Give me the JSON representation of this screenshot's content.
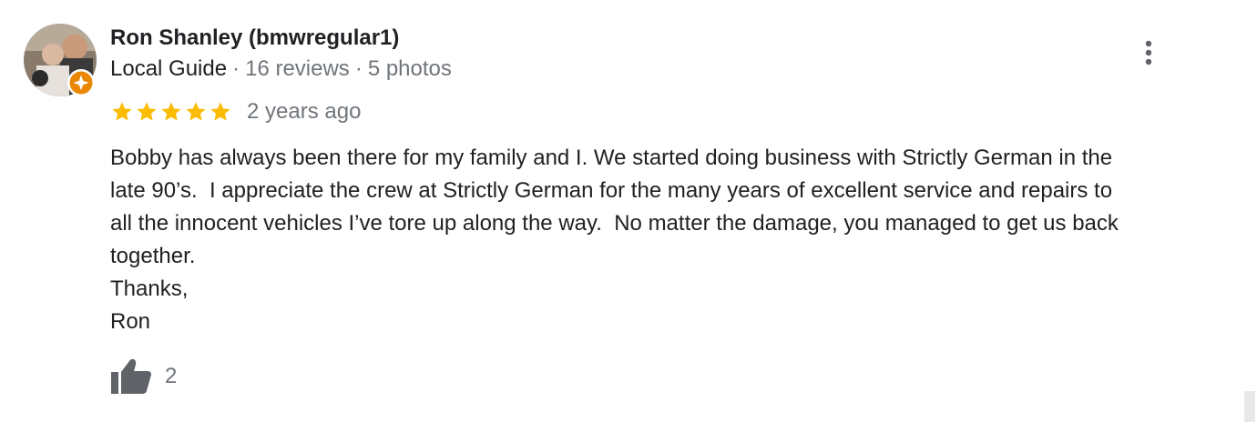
{
  "review": {
    "reviewer_name": "Ron Shanley (bmwregular1)",
    "guide_label": "Local Guide",
    "separator": "·",
    "reviews_count": "16 reviews",
    "photos_count": "5 photos",
    "rating": 5,
    "rating_max": 5,
    "date": "2 years ago",
    "text": "Bobby has always been there for my family and I. We started doing business with Strictly German in the\nlate 90’s.  I appreciate the crew at Strictly German for the many years of excellent service and repairs to\nall the innocent vehicles I’ve tore up along the way.  No matter the damage, you managed to get us back\ntogether.\nThanks,\nRon",
    "like_count": "2"
  },
  "icons": {
    "avatar": "reviewer-avatar-photo",
    "badge": "local-guide-badge-icon",
    "more": "more-vert-icon",
    "star": "star-icon",
    "like": "thumb-up-icon"
  },
  "colors": {
    "star": "#fbbc04",
    "badge": "#ea8600",
    "name": "#202124",
    "secondary": "#70757a",
    "icon": "#5f6368"
  }
}
